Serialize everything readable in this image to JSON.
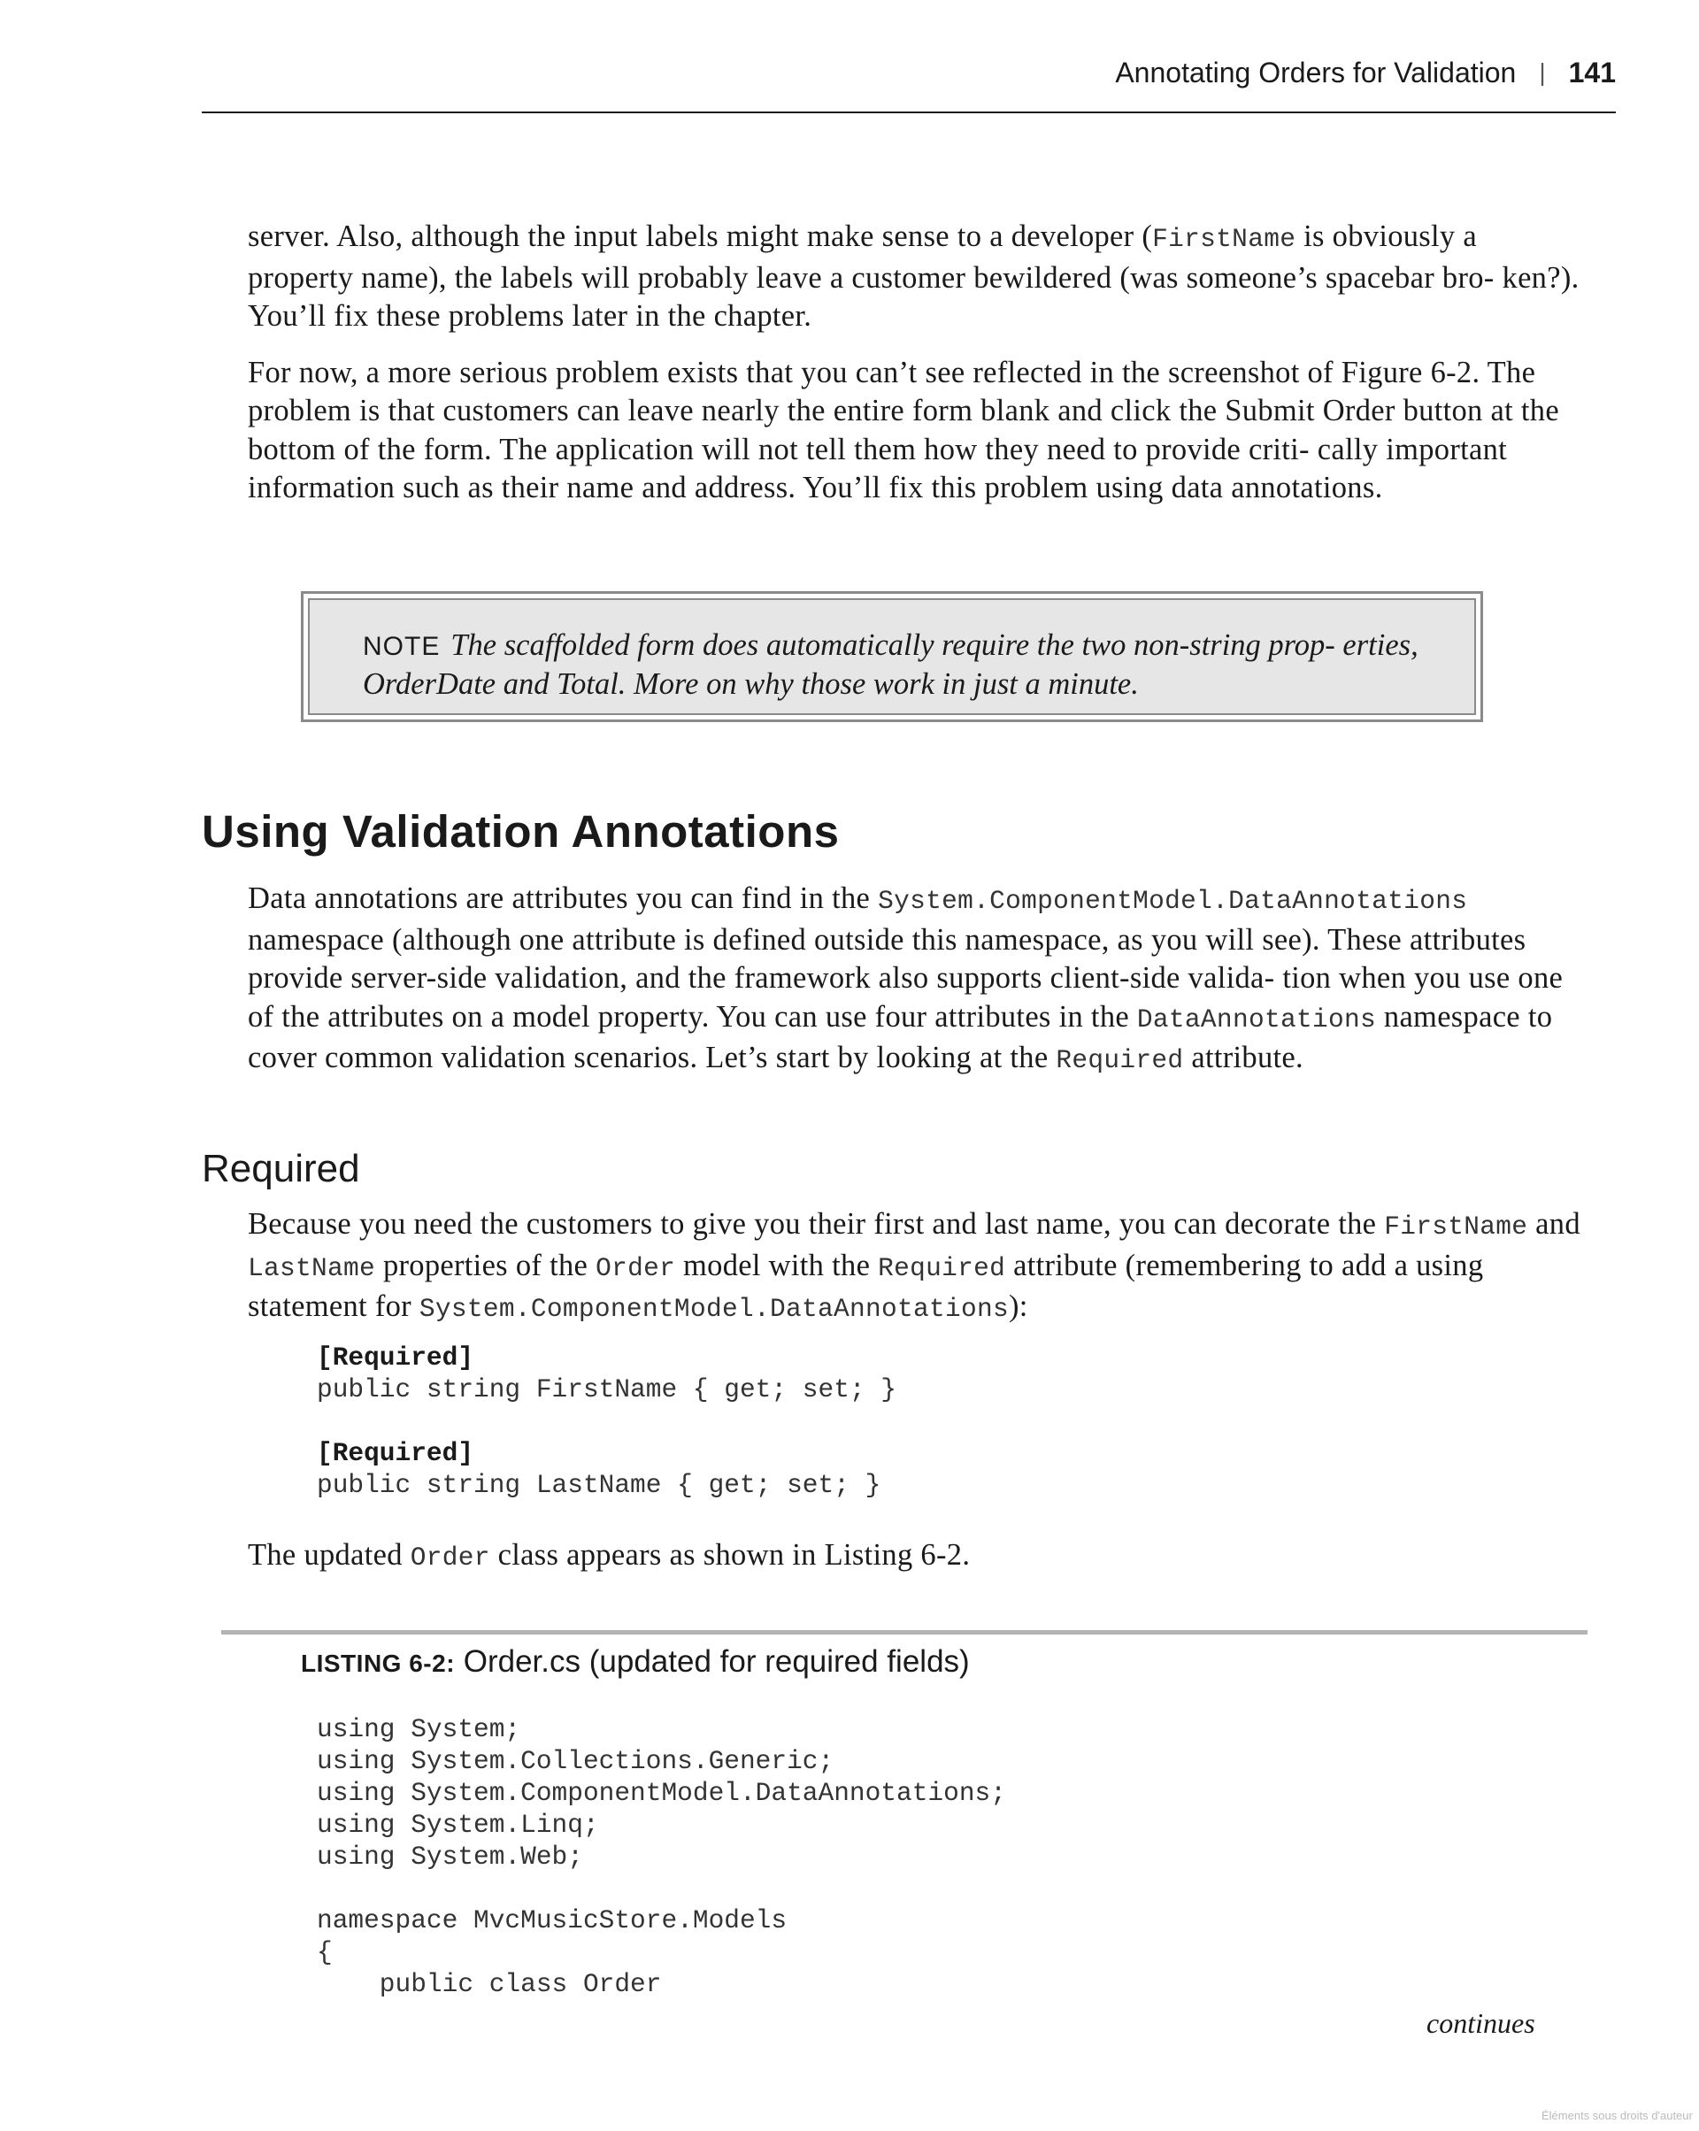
{
  "header": {
    "title": "Annotating Orders for Validation",
    "separator": "|",
    "page_number": "141"
  },
  "intro": {
    "p1": {
      "a": "server. Also, although the input labels might make sense to a developer (",
      "code1": "FirstName",
      "b": " is obviously a property name), the labels will probably leave a customer bewildered (was someone’s spacebar bro- ken?). You’ll fix these problems later in the chapter."
    },
    "p2": "For now, a more serious problem exists that you can’t see reflected in the screenshot of Figure 6-2. The problem is that customers can leave nearly the entire form blank and click the Submit Order button at the bottom of the form. The application will not tell them how they need to provide criti- cally important information such as their name and address. You’ll fix this problem using data annotations."
  },
  "note": {
    "label": "NOTE",
    "text": "The scaffolded form does automatically require the two non-string prop- erties, OrderDate and Total. More on why those work in just a minute."
  },
  "section": {
    "heading": "Using Validation Annotations",
    "p": {
      "a": "Data annotations are attributes you can find in the ",
      "code1": "System.ComponentModel.DataAnnotations",
      "b": " namespace (although one attribute is defined outside this namespace, as you will see). These attributes provide server-side validation, and the framework also supports client-side valida- tion when you use one of the attributes on a model property. You can use four attributes in the ",
      "code2": "DataAnnotations",
      "c": " namespace to cover common validation scenarios. Let’s start by looking at the ",
      "code3": "Required",
      "d": " attribute."
    }
  },
  "required": {
    "heading": "Required",
    "p": {
      "a": "Because you need the customers to give you their first and last name, you can decorate the ",
      "code1": "FirstName",
      "b": " and ",
      "code2": "LastName",
      "c": " properties of the ",
      "code3": "Order",
      "d": " model with the ",
      "code4": "Required",
      "e": " attribute (remembering to add a using statement for ",
      "code5": "System.ComponentModel.DataAnnotations",
      "f": "):"
    },
    "code": {
      "attr1": "[Required]",
      "line1": "public string FirstName { get; set; }",
      "attr2": "[Required]",
      "line2": "public string LastName { get; set; }"
    },
    "after": {
      "a": "The updated ",
      "code1": "Order",
      "b": " class appears as shown in Listing 6-2."
    }
  },
  "listing": {
    "label": "LISTING 6-2:",
    "title": "Order.cs (updated for required fields)",
    "code": "using System;\nusing System.Collections.Generic;\nusing System.ComponentModel.DataAnnotations;\nusing System.Linq;\nusing System.Web;\n\nnamespace MvcMusicStore.Models\n{\n    public class Order"
  },
  "footer": {
    "continues": "continues",
    "watermark": "Éléments sous droits d'auteur"
  }
}
